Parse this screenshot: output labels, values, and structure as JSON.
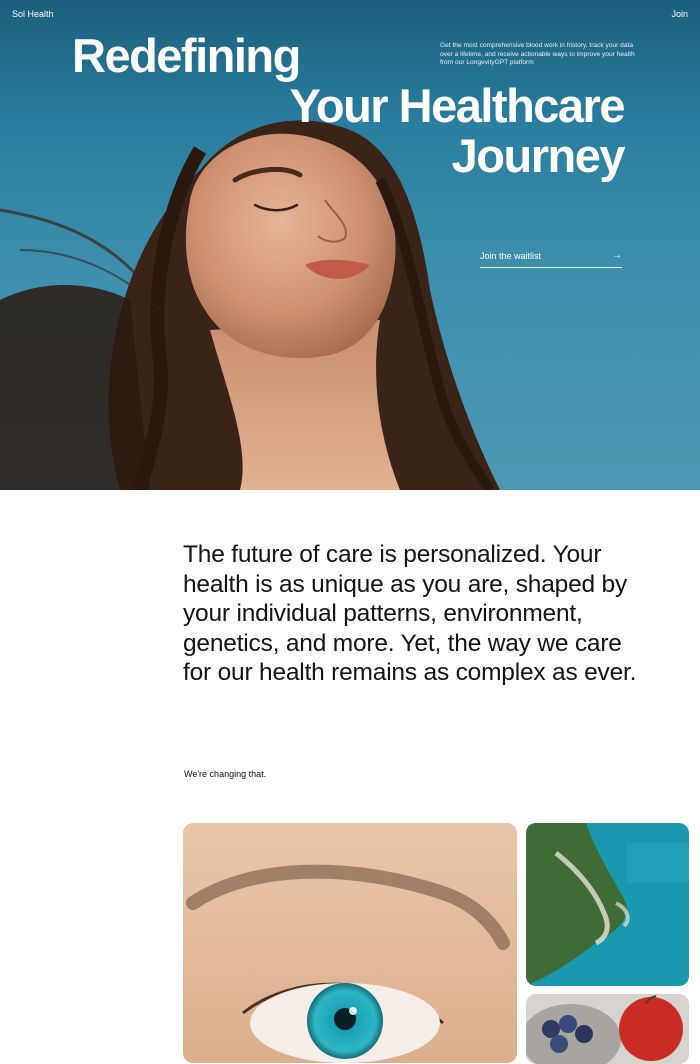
{
  "header": {
    "brand": "Sol Health",
    "join_label": "Join"
  },
  "hero": {
    "headline_line1": "Redefining",
    "headline_line2": "Your Healthcare",
    "headline_line3": "Journey",
    "description": "Get the most comprehensive blood work in history, track your data over a lifetime, and receive actionable ways to improve your health from our LongevityGPT platform",
    "cta_label": "Join the waitlist",
    "cta_icon": "arrow-right-icon"
  },
  "intro": {
    "text": "The future of care is personalized. Your health is as unique as you are, shaped by your individual patterns, environment, genetics, and more. Yet, the way we care for our health remains as complex as ever.",
    "tagline": "We're changing that."
  },
  "colors": {
    "sky": "#3d8fad",
    "text_dark": "#141414",
    "white": "#ffffff"
  }
}
